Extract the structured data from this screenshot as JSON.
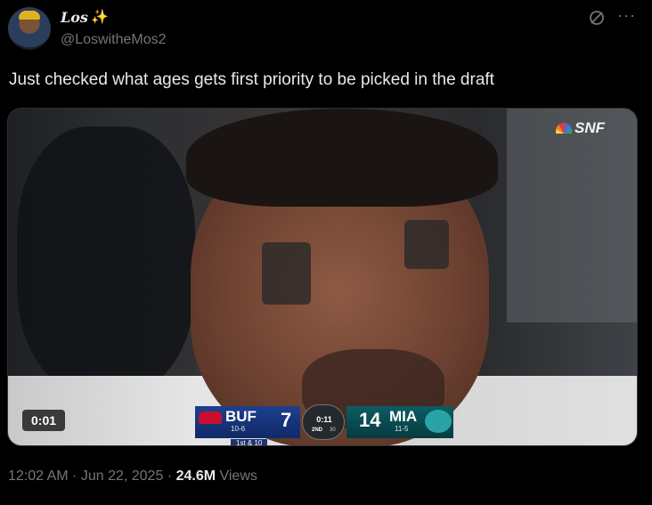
{
  "author": {
    "display_name": "Los",
    "display_name_emoji": "✨",
    "handle": "@LoswitheMos2",
    "avatar_icon": "avatar-image"
  },
  "header_actions": {
    "grok_icon": "grok-icon",
    "more_icon": "more-icon"
  },
  "tweet": {
    "text": "Just checked what ages gets first priority to be picked in the draft"
  },
  "media": {
    "type": "video",
    "timer": "0:01",
    "network_bug": "SNF",
    "scoreboard": {
      "away_team": "BUF",
      "away_record": "10-6",
      "away_score": "7",
      "clock": "0:11",
      "quarter": "2ND",
      "timeouts_label": "30",
      "home_score": "14",
      "home_team": "MIA",
      "home_record": "11-5",
      "down_distance": "1st & 10"
    },
    "colors": {
      "away_primary": "#1f3f8f",
      "home_primary": "#0c5c63"
    }
  },
  "meta": {
    "time": "12:02 AM",
    "separator": " · ",
    "date": "Jun 22, 2025",
    "views_count": "24.6M",
    "views_label": " Views"
  }
}
